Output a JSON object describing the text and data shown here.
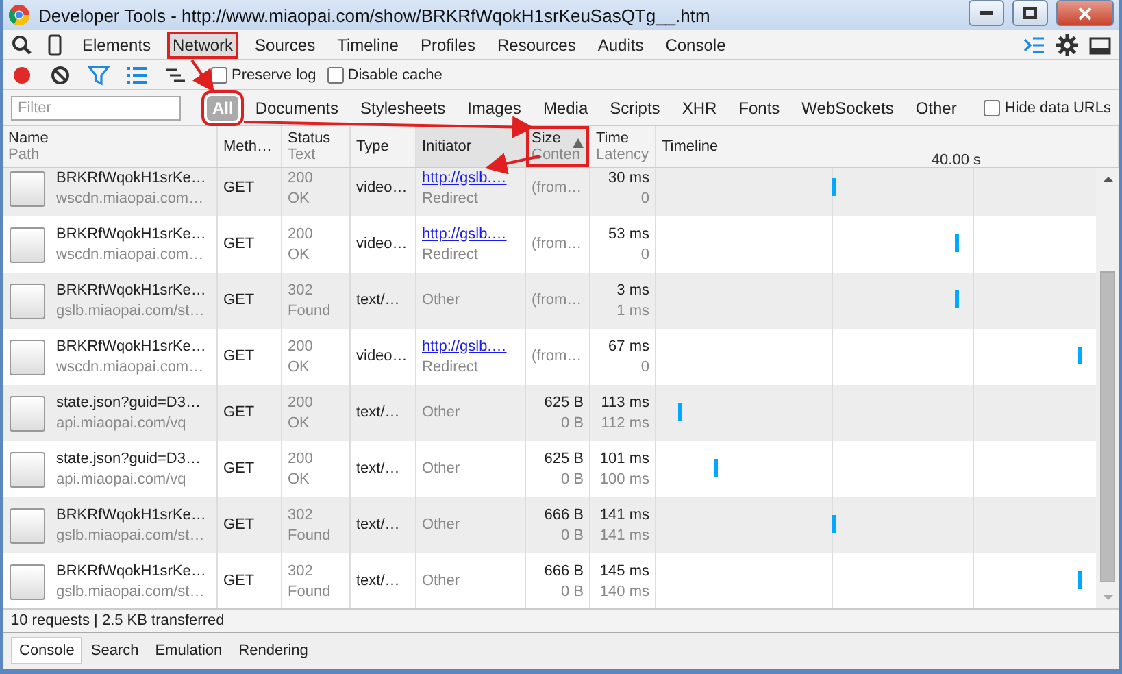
{
  "window": {
    "title": "Developer Tools - http://www.miaopai.com/show/BRKRfWqokH1srKeuSasQTg__.htm"
  },
  "panel_tabs": [
    {
      "label": "Elements",
      "selected": false,
      "highlighted": false
    },
    {
      "label": "Network",
      "selected": true,
      "highlighted": true
    },
    {
      "label": "Sources",
      "selected": false,
      "highlighted": false
    },
    {
      "label": "Timeline",
      "selected": false,
      "highlighted": false
    },
    {
      "label": "Profiles",
      "selected": false,
      "highlighted": false
    },
    {
      "label": "Resources",
      "selected": false,
      "highlighted": false
    },
    {
      "label": "Audits",
      "selected": false,
      "highlighted": false
    },
    {
      "label": "Console",
      "selected": false,
      "highlighted": false
    }
  ],
  "toolbar": {
    "recording": true,
    "filter_active": true,
    "large_rows": true,
    "options": [
      {
        "label": "Preserve log",
        "checked": false
      },
      {
        "label": "Disable cache",
        "checked": false
      }
    ]
  },
  "filter": {
    "placeholder": "Filter",
    "types": [
      {
        "label": "All",
        "selected": true,
        "highlighted": true
      },
      {
        "label": "Documents",
        "selected": false,
        "highlighted": false
      },
      {
        "label": "Stylesheets",
        "selected": false,
        "highlighted": false
      },
      {
        "label": "Images",
        "selected": false,
        "highlighted": false
      },
      {
        "label": "Media",
        "selected": false,
        "highlighted": false
      },
      {
        "label": "Scripts",
        "selected": false,
        "highlighted": false
      },
      {
        "label": "XHR",
        "selected": false,
        "highlighted": false
      },
      {
        "label": "Fonts",
        "selected": false,
        "highlighted": false
      },
      {
        "label": "WebSockets",
        "selected": false,
        "highlighted": false
      },
      {
        "label": "Other",
        "selected": false,
        "highlighted": false
      }
    ],
    "hide_data_urls": {
      "label": "Hide data URLs",
      "checked": false
    }
  },
  "table": {
    "columns": [
      {
        "title": "Name",
        "subtitle": "Path",
        "highlighted": false,
        "sorted": false
      },
      {
        "title": "Meth…",
        "highlighted": false,
        "sorted": false
      },
      {
        "title": "Status",
        "subtitle": "Text",
        "highlighted": false,
        "sorted": false
      },
      {
        "title": "Type",
        "highlighted": false,
        "sorted": false
      },
      {
        "title": "Initiator",
        "highlighted": false,
        "sorted": true
      },
      {
        "title": "Size",
        "subtitle": "Conten",
        "highlighted": true,
        "sorted": true
      },
      {
        "title": "Time",
        "subtitle": "Latency",
        "highlighted": false,
        "sorted": false
      },
      {
        "title": "Timeline",
        "highlighted": false,
        "sorted": false
      }
    ],
    "timeline_scale": "40.00 s",
    "rows": [
      {
        "name": "BRKRfWqokH1srKe…",
        "path": "wscdn.miaopai.com…",
        "method": "GET",
        "status": "200",
        "status_text": "OK",
        "type": "video…",
        "initiator": {
          "kind": "link",
          "text": "http://gslb.…",
          "sub": "Redirect"
        },
        "size": "(from…",
        "time": "30 ms",
        "latency": "0",
        "timeline": {
          "level": 0.4
        }
      },
      {
        "name": "BRKRfWqokH1srKe…",
        "path": "wscdn.miaopai.com…",
        "method": "GET",
        "status": "200",
        "status_text": "OK",
        "type": "video…",
        "initiator": {
          "kind": "link",
          "text": "http://gslb.…",
          "sub": "Redirect"
        },
        "size": "(from…",
        "time": "53 ms",
        "latency": "0",
        "timeline": {
          "level": 0.68
        }
      },
      {
        "name": "BRKRfWqokH1srKe…",
        "path": "gslb.miaopai.com/st…",
        "method": "GET",
        "status": "302",
        "status_text": "Found",
        "type": "text/…",
        "initiator": {
          "kind": "plain",
          "text": "Other"
        },
        "size": "(from…",
        "time": "3 ms",
        "latency": "1 ms",
        "timeline": {
          "level": 0.68
        }
      },
      {
        "name": "BRKRfWqokH1srKe…",
        "path": "wscdn.miaopai.com…",
        "method": "GET",
        "status": "200",
        "status_text": "OK",
        "type": "video…",
        "initiator": {
          "kind": "link",
          "text": "http://gslb.…",
          "sub": "Redirect"
        },
        "size": "(from…",
        "time": "67 ms",
        "latency": "0",
        "timeline": {
          "level": 0.96
        }
      },
      {
        "name": "state.json?guid=D3…",
        "path": "api.miaopai.com/vq",
        "method": "GET",
        "status": "200",
        "status_text": "OK",
        "type": "text/…",
        "initiator": {
          "kind": "plain",
          "text": "Other"
        },
        "size": "625 B",
        "content": "0 B",
        "time": "113 ms",
        "latency": "112 ms",
        "timeline": {
          "level": 0.05
        }
      },
      {
        "name": "state.json?guid=D3…",
        "path": "api.miaopai.com/vq",
        "method": "GET",
        "status": "200",
        "status_text": "OK",
        "type": "text/…",
        "initiator": {
          "kind": "plain",
          "text": "Other"
        },
        "size": "625 B",
        "content": "0 B",
        "time": "101 ms",
        "latency": "100 ms",
        "timeline": {
          "level": 0.13
        }
      },
      {
        "name": "BRKRfWqokH1srKe…",
        "path": "gslb.miaopai.com/st…",
        "method": "GET",
        "status": "302",
        "status_text": "Found",
        "type": "text/…",
        "initiator": {
          "kind": "plain",
          "text": "Other"
        },
        "size": "666 B",
        "content": "0 B",
        "time": "141 ms",
        "latency": "141 ms",
        "timeline": {
          "level": 0.4
        }
      },
      {
        "name": "BRKRfWqokH1srKe…",
        "path": "gslb.miaopai.com/st…",
        "method": "GET",
        "status": "302",
        "status_text": "Found",
        "type": "text/…",
        "initiator": {
          "kind": "plain",
          "text": "Other"
        },
        "size": "666 B",
        "content": "0 B",
        "time": "145 ms",
        "latency": "140 ms",
        "timeline": {
          "level": 0.96
        }
      }
    ]
  },
  "status_bar": "10 requests | 2.5 KB transferred",
  "drawer_tabs": [
    {
      "label": "Console",
      "selected": true
    },
    {
      "label": "Search",
      "selected": false
    },
    {
      "label": "Emulation",
      "selected": false
    },
    {
      "label": "Rendering",
      "selected": false
    }
  ]
}
